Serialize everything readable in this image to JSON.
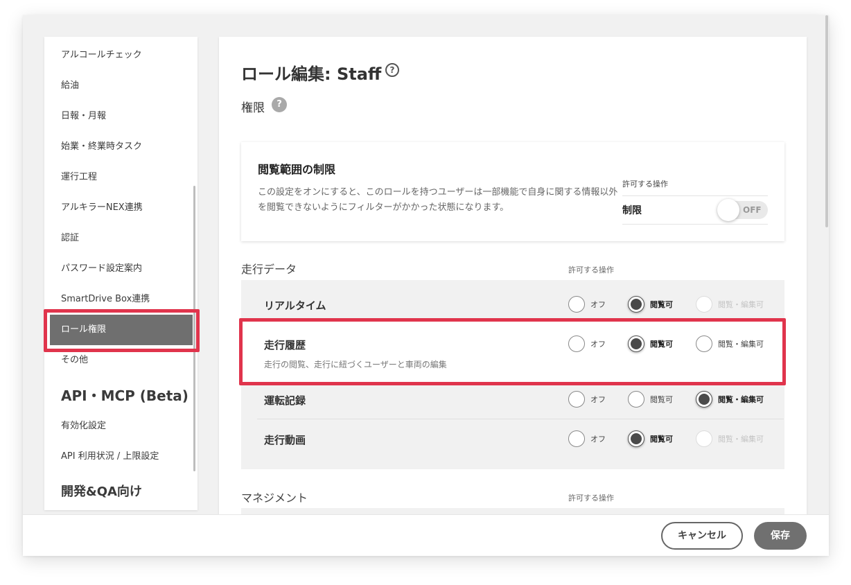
{
  "sidebar": {
    "items": [
      {
        "label": "アルコールチェック"
      },
      {
        "label": "給油"
      },
      {
        "label": "日報・月報"
      },
      {
        "label": "始業・終業時タスク"
      },
      {
        "label": "運行工程"
      },
      {
        "label": "アルキラーNEX連携"
      },
      {
        "label": "認証"
      },
      {
        "label": "パスワード設定案内"
      },
      {
        "label": "SmartDrive Box連携"
      },
      {
        "label": "ロール権限"
      },
      {
        "label": "その他"
      }
    ],
    "heading_api": "API・MCP (Beta)",
    "items2": [
      {
        "label": "有効化設定"
      },
      {
        "label": "API 利用状況 / 上限設定"
      }
    ],
    "heading_dev": "開発&QA向け"
  },
  "main": {
    "title": "ロール編集: Staff",
    "title_help": "?",
    "subtitle": "権限",
    "subtitle_help": "?",
    "restrict": {
      "title": "閲覧範囲の制限",
      "description": "この設定をオンにすると、このロールを持つユーザーは一部機能で自身に関する情報以外を閲覧できないようにフィルターがかかった状態になります。",
      "perm_label": "許可する操作",
      "name": "制限",
      "toggle": "OFF"
    },
    "section_driving": {
      "label": "走行データ",
      "perm_label": "許可する操作",
      "rows": [
        {
          "name": "リアルタイム",
          "desc": "",
          "opt_off": "オフ",
          "opt_view": "閲覧可",
          "opt_edit": "閲覧・編集可",
          "selected": "view",
          "edit_disabled": true
        },
        {
          "name": "走行履歴",
          "desc": "走行の閲覧、走行に紐づくユーザーと車両の編集",
          "opt_off": "オフ",
          "opt_view": "閲覧可",
          "opt_edit": "閲覧・編集可",
          "selected": "view",
          "edit_disabled": false
        },
        {
          "name": "運転記録",
          "desc": "",
          "opt_off": "オフ",
          "opt_view": "閲覧可",
          "opt_edit": "閲覧・編集可",
          "selected": "edit",
          "edit_disabled": false
        },
        {
          "name": "走行動画",
          "desc": "",
          "opt_off": "オフ",
          "opt_view": "閲覧可",
          "opt_edit": "閲覧・編集可",
          "selected": "view",
          "edit_disabled": true
        }
      ]
    },
    "section_management": {
      "label": "マネジメント",
      "perm_label": "許可する操作"
    }
  },
  "footer": {
    "cancel": "キャンセル",
    "save": "保存"
  },
  "colors": {
    "highlight": "#e0344c",
    "active_sidebar": "#6f6f6f",
    "save_button": "#707070"
  }
}
